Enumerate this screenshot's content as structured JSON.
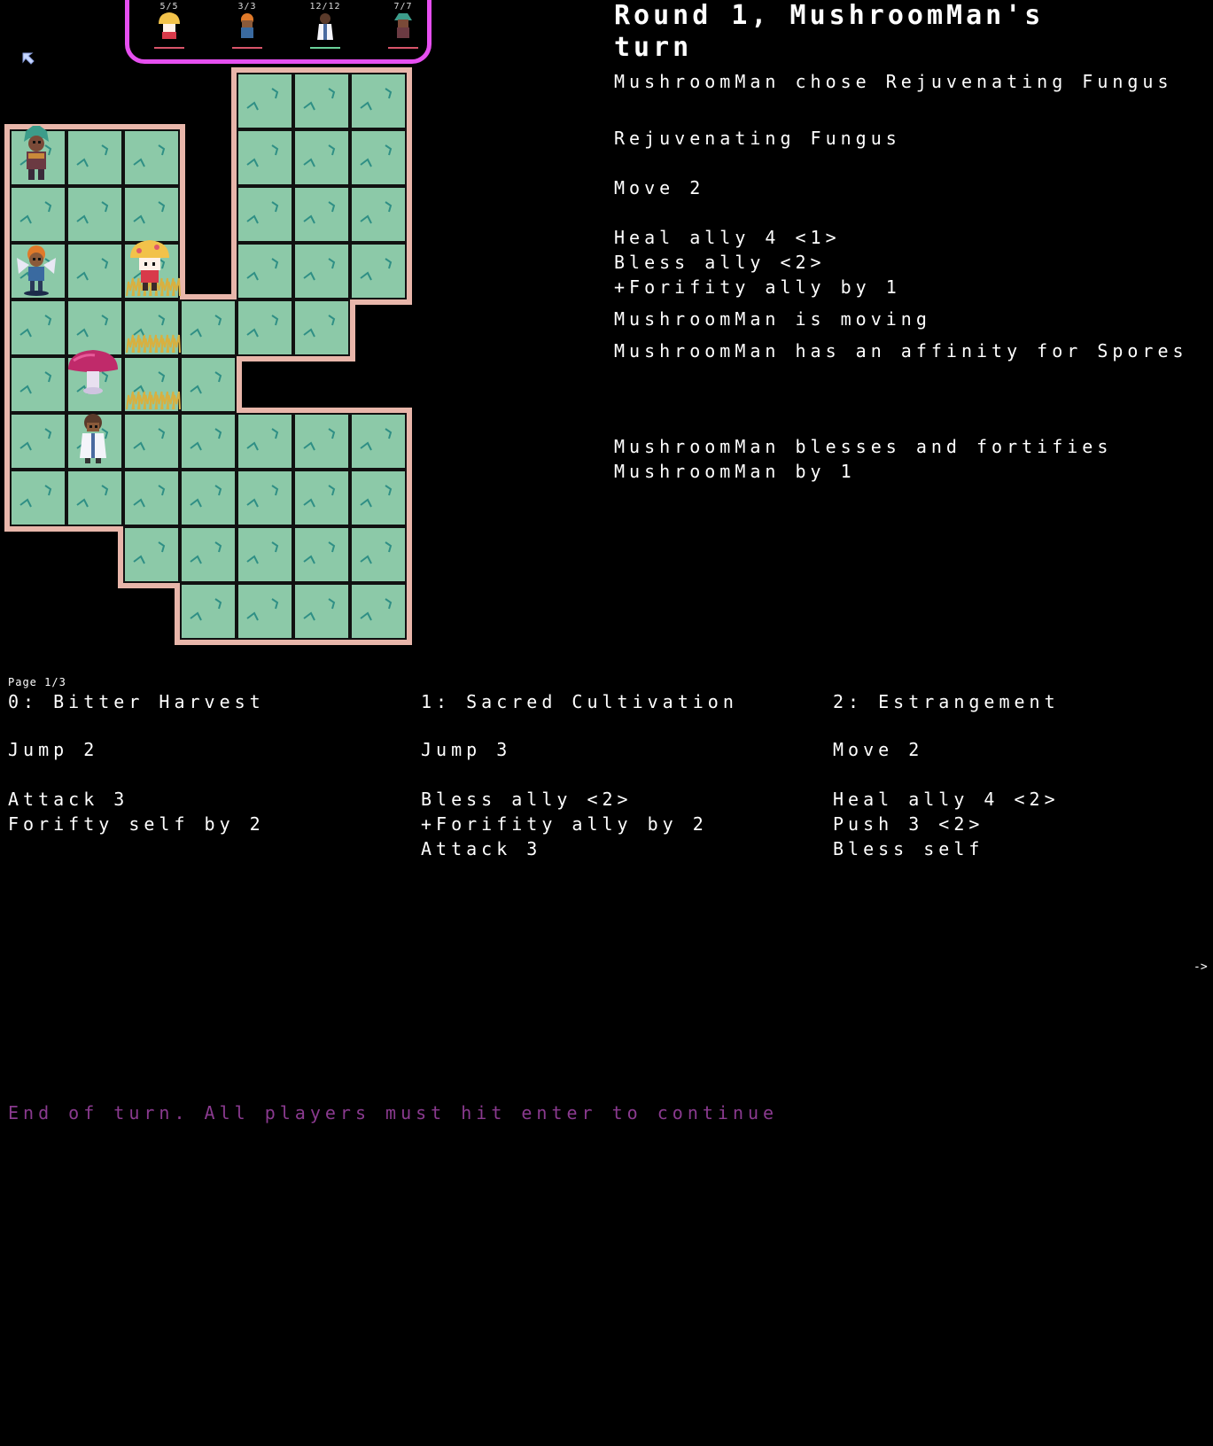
{
  "turn_order": [
    {
      "hp": "5/5",
      "name": "mushroom-hero",
      "underline": "#d8546a"
    },
    {
      "hp": "3/3",
      "name": "fox-hero",
      "underline": "#d8546a"
    },
    {
      "hp": "12/12",
      "name": "robed-hero",
      "underline": "#6ad29a"
    },
    {
      "hp": "7/7",
      "name": "teal-hero",
      "underline": "#d8546a"
    }
  ],
  "log": {
    "title_line1": "Round 1, MushroomMan's",
    "title_line2": "turn",
    "chose": "MushroomMan chose Rejuvenating Fungus",
    "card_name": "Rejuvenating Fungus",
    "card_move": "Move 2",
    "card_effects": [
      "Heal ally 4 <1>",
      "Bless ally <2>",
      "+Forifity ally by 1"
    ],
    "moving": "MushroomMan is moving",
    "affinity": "MushroomMan has an affinity for Spores",
    "result_line1": "MushroomMan blesses and fortifies",
    "result_line2": "MushroomMan by 1"
  },
  "cards": {
    "page": "Page 1/3",
    "items": [
      {
        "title": "0: Bitter Harvest",
        "move": "Jump 2",
        "effects": [
          "Attack 3",
          "Forifty self by 2"
        ]
      },
      {
        "title": "1: Sacred Cultivation",
        "move": "Jump 3",
        "effects": [
          "Bless ally <2>",
          "+Forifity ally by 2",
          "Attack 3"
        ]
      },
      {
        "title": "2: Estrangement",
        "move": "Move 2",
        "effects": [
          "Heal ally 4 <2>",
          "Push 3 <2>",
          "Bless self"
        ]
      }
    ],
    "next_arrow": "->"
  },
  "end_message": "End of turn. All players must hit enter to continue",
  "colors": {
    "tile": "#8cc9a8",
    "tile_crack": "#2f8f85",
    "wall": "#e8b6aa",
    "turn_frame": "#e64ff0",
    "end_text": "#8a3a8f"
  }
}
